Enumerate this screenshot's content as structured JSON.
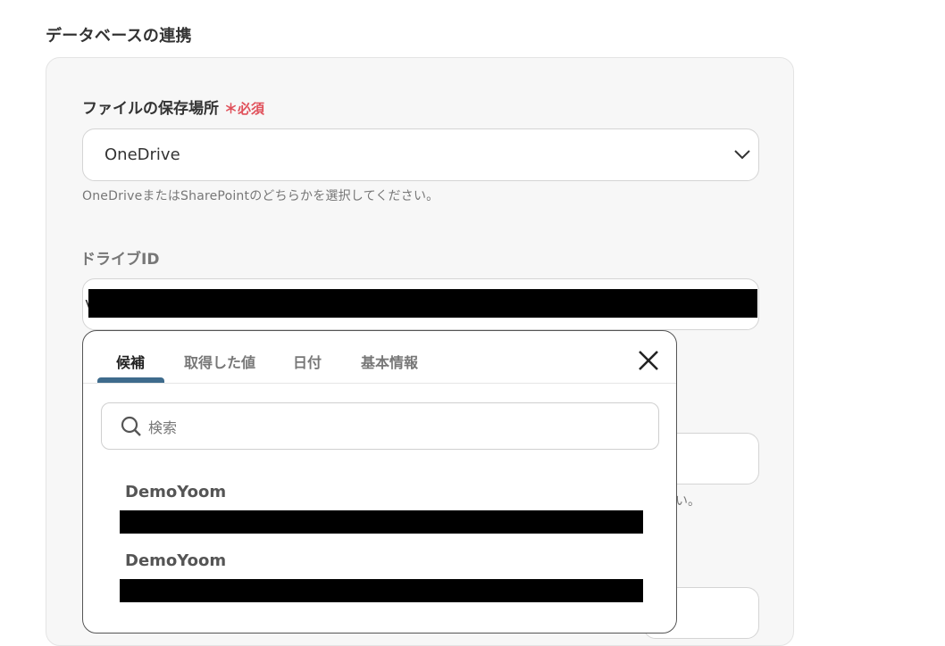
{
  "section_title": "データベースの連携",
  "storage_field": {
    "label": "ファイルの保存場所",
    "required_mark": "＊必須",
    "selected_value": "OneDrive",
    "help": "OneDriveまたはSharePointのどちらかを選択してください。"
  },
  "drive_id_field": {
    "label": "ドライブID",
    "visible_prefix": "v"
  },
  "partial_help_text": "い。",
  "popover": {
    "tabs": [
      {
        "label": "候補"
      },
      {
        "label": "取得した値"
      },
      {
        "label": "日付"
      },
      {
        "label": "基本情報"
      }
    ],
    "search_placeholder": "検索",
    "options": [
      {
        "name": "DemoYoom"
      },
      {
        "name": "DemoYoom"
      }
    ]
  },
  "colors": {
    "accent": "#3e6b8c",
    "required": "#e0505a",
    "panel_bg": "#f7f7f7"
  },
  "icons": [
    "chevron-down-icon",
    "close-icon",
    "search-icon"
  ]
}
